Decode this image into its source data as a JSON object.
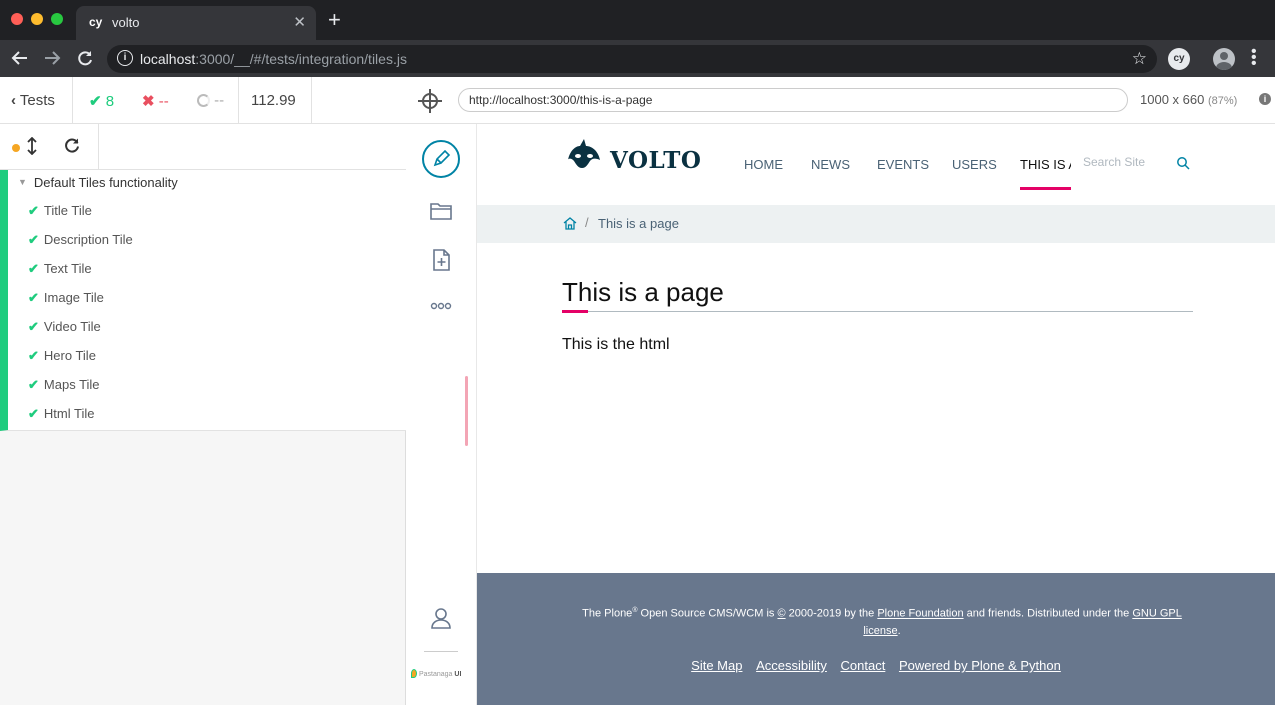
{
  "browser": {
    "tab_favicon": "cy",
    "tab_title": "volto",
    "tab_close": "✕",
    "new_tab": "+",
    "url_host": "localhost",
    "url_rest": ":3000/__/#/tests/integration/tiles.js",
    "extension_label": "cy"
  },
  "reporter": {
    "back_label": "Tests",
    "passed": "8",
    "failed": "--",
    "pending": "--",
    "duration": "112.99",
    "suite": {
      "title": "Default Tiles functionality",
      "tests": [
        "Title Tile",
        "Description Tile",
        "Text Tile",
        "Image Tile",
        "Video Tile",
        "Hero Tile",
        "Maps Tile",
        "Html Tile"
      ]
    }
  },
  "aut_header": {
    "url": "http://localhost:3000/this-is-a-page",
    "viewport": "1000 x 660",
    "zoom": "(87%)"
  },
  "site": {
    "logo": "VOLTO",
    "nav": [
      "HOME",
      "NEWS",
      "EVENTS",
      "USERS",
      "THIS IS A"
    ],
    "search_placeholder": "Search Site",
    "breadcrumb_sep": "/",
    "breadcrumb_current": "This is a page",
    "page_title": "This is a page",
    "page_body": "This is the html",
    "footer": {
      "prefix": "The Plone",
      "reg": "®",
      "middle": " Open Source CMS/WCM is ",
      "copyright": "©",
      "years": " 2000-2019 by the ",
      "foundation": "Plone Foundation",
      "friends": " and friends. Distributed under the ",
      "gpl": "GNU GPL license",
      "period": ".",
      "links": [
        "Site Map",
        "Accessibility",
        "Contact",
        "Powered by Plone & Python"
      ]
    }
  },
  "toolbar": {
    "pastanaga_prefix": "Pastanaga",
    "pastanaga_suffix": "UI"
  },
  "colors": {
    "accent": "#e40166",
    "link": "#0083a5",
    "pass": "#1fcc7e",
    "fail": "#e94f5f",
    "footer": "#68778d"
  }
}
